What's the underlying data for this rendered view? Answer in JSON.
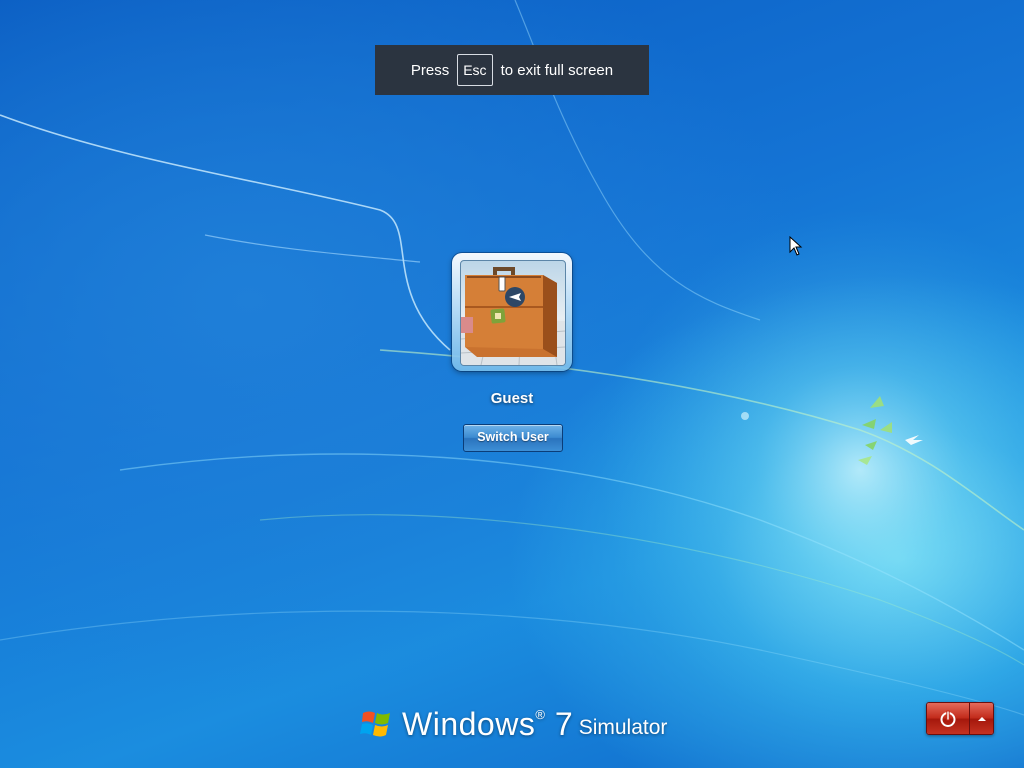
{
  "fullscreen_notice": {
    "prefix": "Press",
    "key": "Esc",
    "suffix": "to exit full screen"
  },
  "user": {
    "name": "Guest",
    "picture_icon": "suitcase-icon"
  },
  "switch_user_label": "Switch User",
  "branding": {
    "windows": "Windows",
    "registered": "®",
    "version": "7",
    "product": "Simulator",
    "logo_icon": "windows-flag-icon"
  },
  "power": {
    "shutdown_icon": "power-icon",
    "options_icon": "triangle-up-icon"
  },
  "colors": {
    "banner_bg": "#2b3440",
    "power_red": "#c22b1b",
    "switch_button_blue": "#3c8bd1"
  }
}
